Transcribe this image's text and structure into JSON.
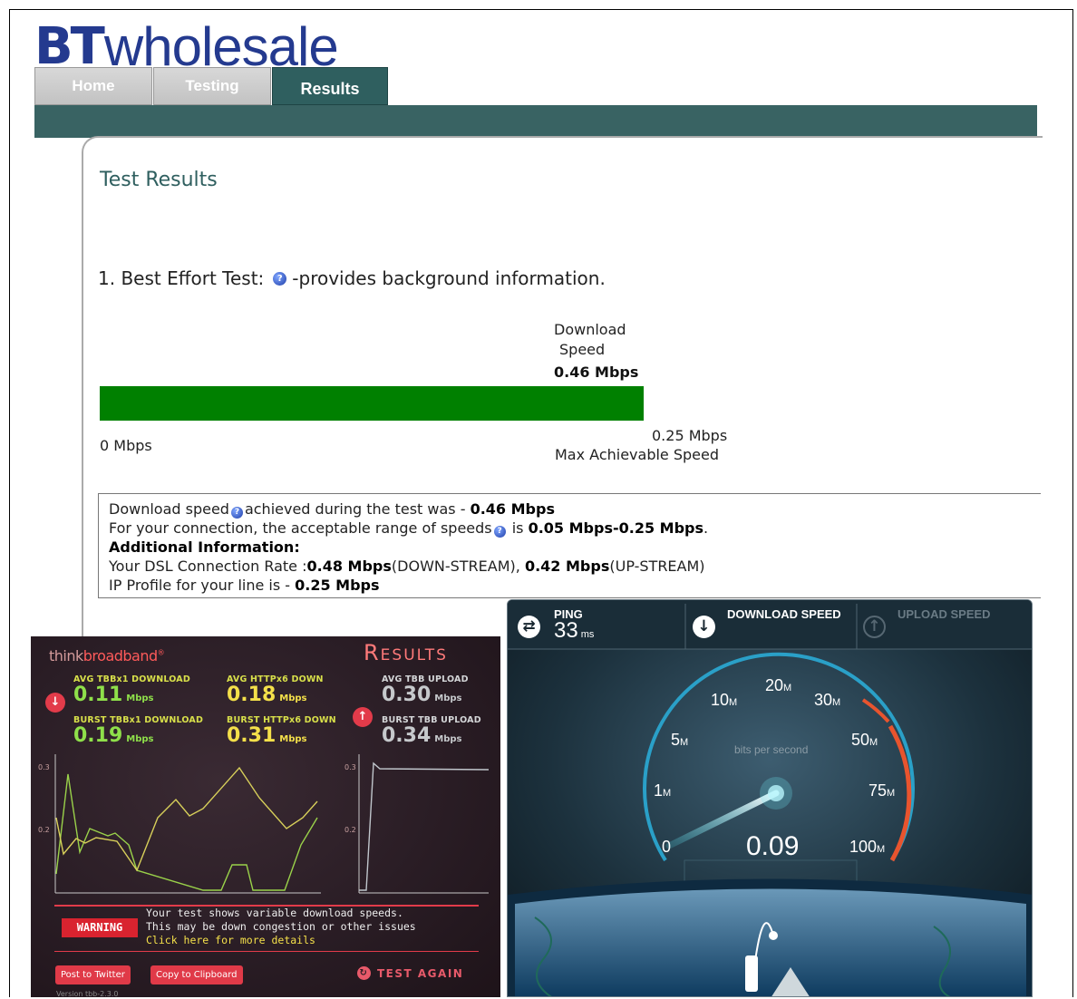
{
  "bt": {
    "logo_bt": "BT",
    "logo_wholesale": "wholesale",
    "tabs": [
      {
        "label": "Home",
        "active": false
      },
      {
        "label": "Testing",
        "active": false
      },
      {
        "label": "Results",
        "active": true
      }
    ],
    "page_title": "Test Results",
    "best_effort": {
      "prefix": "1. Best Effort Test:",
      "suffix": "-provides background information."
    },
    "download_label_1": "Download",
    "download_label_2": "Speed",
    "download_value": "0.46 Mbps",
    "bar_fill_fraction": 1.0,
    "bar_color": "#008000",
    "zero_label": "0 Mbps",
    "max_value": "0.25 Mbps",
    "max_label": "Max Achievable Speed",
    "info": {
      "line1_prefix": "Download speed",
      "line1_mid": "achieved during the test was - ",
      "line1_value": "0.46 Mbps",
      "line2_prefix": "For your connection, the acceptable range of speeds",
      "line2_mid": " is ",
      "line2_value": "0.05 Mbps-0.25 Mbps",
      "line2_end": ".",
      "heading": "Additional Information:",
      "line3_prefix": "Your DSL Connection Rate :",
      "line3_down": "0.48 Mbps",
      "line3_down_label": "(DOWN-STREAM), ",
      "line3_up": "0.42 Mbps",
      "line3_up_label": "(UP-STREAM)",
      "line4_prefix": "IP Profile for your line is - ",
      "line4_value": "0.25 Mbps"
    }
  },
  "tbb": {
    "logo_think": "think",
    "logo_broadband": "broadband",
    "logo_reg": "®",
    "title": "Results",
    "stats": [
      {
        "label": "AVG TBBx1 DOWNLOAD",
        "value": "0.11",
        "unit": "Mbps"
      },
      {
        "label": "AVG HTTPx6 DOWN",
        "value": "0.18",
        "unit": "Mbps"
      },
      {
        "label": "AVG TBB UPLOAD",
        "value": "0.30",
        "unit": "Mbps"
      },
      {
        "label": "BURST TBBx1 DOWNLOAD",
        "value": "0.19",
        "unit": "Mbps"
      },
      {
        "label": "BURST HTTPx6 DOWN",
        "value": "0.31",
        "unit": "Mbps"
      },
      {
        "label": "BURST TBB UPLOAD",
        "value": "0.34",
        "unit": "Mbps"
      }
    ],
    "chart_ticks": [
      "0.3",
      "0.2"
    ],
    "warning_badge": "WARNING",
    "warning_line1": "Your test shows variable download speeds.",
    "warning_line2": "This may be down congestion or other issues",
    "warning_link": "Click here for more details",
    "btn_twitter": "Post to Twitter",
    "btn_clipboard": "Copy to Clipboard",
    "btn_again": "TEST AGAIN",
    "version": "Version tbb-2.3.0",
    "colors": {
      "accent": "#e23b4a",
      "green": "#8fe04a",
      "yellow": "#f4e04a"
    }
  },
  "speedtest": {
    "ping_label": "PING",
    "ping_value": "33",
    "ping_unit": "ms",
    "download_label": "DOWNLOAD SPEED",
    "upload_label": "UPLOAD SPEED",
    "units_label": "bits per second",
    "reading": "0.09",
    "gauge_labels": [
      {
        "num": "0",
        "unit": ""
      },
      {
        "num": "1",
        "unit": "M"
      },
      {
        "num": "5",
        "unit": "M"
      },
      {
        "num": "10",
        "unit": "M"
      },
      {
        "num": "20",
        "unit": "M"
      },
      {
        "num": "30",
        "unit": "M"
      },
      {
        "num": "50",
        "unit": "M"
      },
      {
        "num": "75",
        "unit": "M"
      },
      {
        "num": "100",
        "unit": "M"
      }
    ],
    "colors": {
      "arc": "#2aa0c8",
      "hot": "#e8542e"
    }
  }
}
